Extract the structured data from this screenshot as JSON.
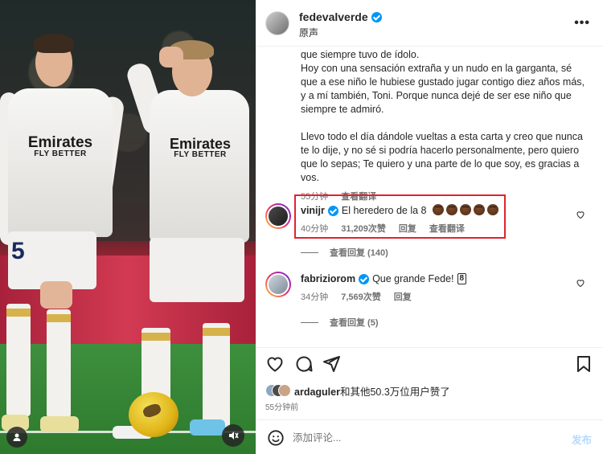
{
  "header": {
    "username": "fedevalverde",
    "subtitle": "原声",
    "more_icon": "more-horizontal-icon"
  },
  "caption": {
    "paragraphs": [
      "que siempre tuvo de ídolo.\nHoy con una sensación extraña y un nudo en la garganta, sé que a ese niño le hubiese gustado jugar contigo diez años más, y a mí también, Toni. Porque nunca dejé de ser ese niño que siempre te admiró.",
      "Llevo todo el día dándole vueltas a esta carta y creo que nunca te lo dije, y no sé si podría hacerlo personalmente, pero quiero que lo sepas; Te quiero y una parte de lo que soy, es gracias a vos."
    ],
    "time": "55分钟",
    "translate": "查看翻译"
  },
  "comments": [
    {
      "username": "vinijr",
      "text": "El heredero de la 8",
      "emoji_count": 5,
      "time": "40分钟",
      "likes": "31,209次赞",
      "reply": "回复",
      "translate": "查看翻译",
      "view_replies": "查看回复 (140)"
    },
    {
      "username": "fabriziorom",
      "text": "Que grande Fede!",
      "badge": "8",
      "time": "34分钟",
      "likes": "7,569次赞",
      "reply": "回复",
      "view_replies": "查看回复 (5)"
    }
  ],
  "likes_line": {
    "user": "ardaguler",
    "rest": "和其他50.3万位用户赞了"
  },
  "post_time": "55分钟前",
  "add_comment": {
    "placeholder": "添加评论...",
    "post_label": "发布"
  },
  "colors": {
    "verified": "#0095f6",
    "highlight": "#e0232e",
    "post_disabled": "#b3dbff"
  }
}
